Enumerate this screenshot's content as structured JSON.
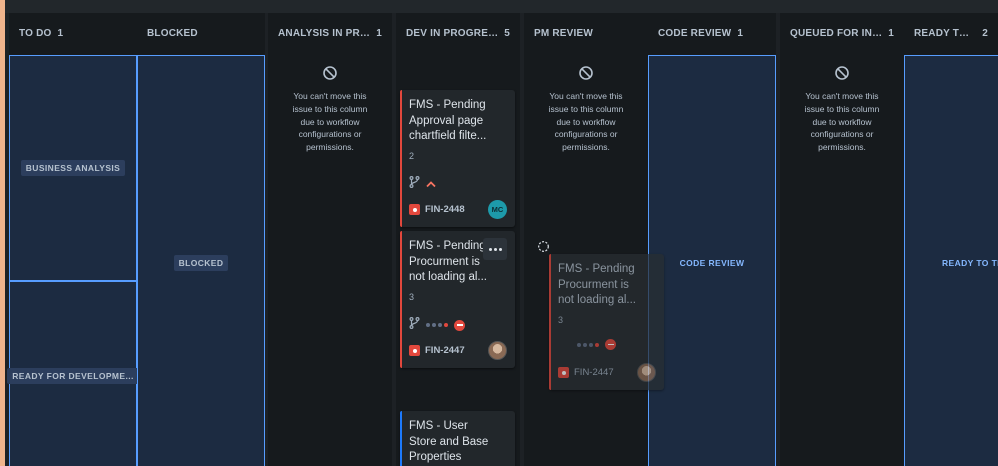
{
  "columns": [
    {
      "name": "TO DO",
      "count": "1"
    },
    {
      "name": "BLOCKED",
      "count": ""
    },
    {
      "name": "ANALYSIS IN PROGR...",
      "count": "1"
    },
    {
      "name": "DEV IN PROGRESS",
      "count": "5"
    },
    {
      "name": "PM REVIEW",
      "count": ""
    },
    {
      "name": "CODE REVIEW",
      "count": "1"
    },
    {
      "name": "QUEUED FOR INTEGR...",
      "count": "1"
    },
    {
      "name": "READY TO TEST",
      "count": "2"
    }
  ],
  "drop_zones": {
    "business_analysis": "BUSINESS ANALYSIS",
    "ready_for_development": "READY FOR DEVELOPME...",
    "blocked": "BLOCKED",
    "code_review": "CODE REVIEW",
    "ready_to_test": "READY TO TEST"
  },
  "no_move_message": "You can't move this issue to this column due to workflow configurations or permissions.",
  "cards": [
    {
      "title": "FMS - Pending Approval page chartfield filte...",
      "points": "2",
      "key": "FIN-2448",
      "assignee_initials": "MC",
      "priority": "high",
      "accent_color": "#e2483d"
    },
    {
      "title": "FMS - Pending Procurment is not loading al...",
      "points": "3",
      "key": "FIN-2447",
      "priority": "blocker",
      "accent_color": "#e2483d"
    },
    {
      "title": "FMS - User Store and Base Properties",
      "accent_color": "#1d7afc"
    }
  ],
  "dragged_card": {
    "title": "FMS - Pending Procurment is not loading al...",
    "points": "3",
    "key": "FIN-2447"
  },
  "colors": {
    "background": "#1d2125",
    "column": "#161a1d",
    "drop_zone": "#1c2b41",
    "drop_border": "#579dff",
    "bug": "#e2483d"
  }
}
